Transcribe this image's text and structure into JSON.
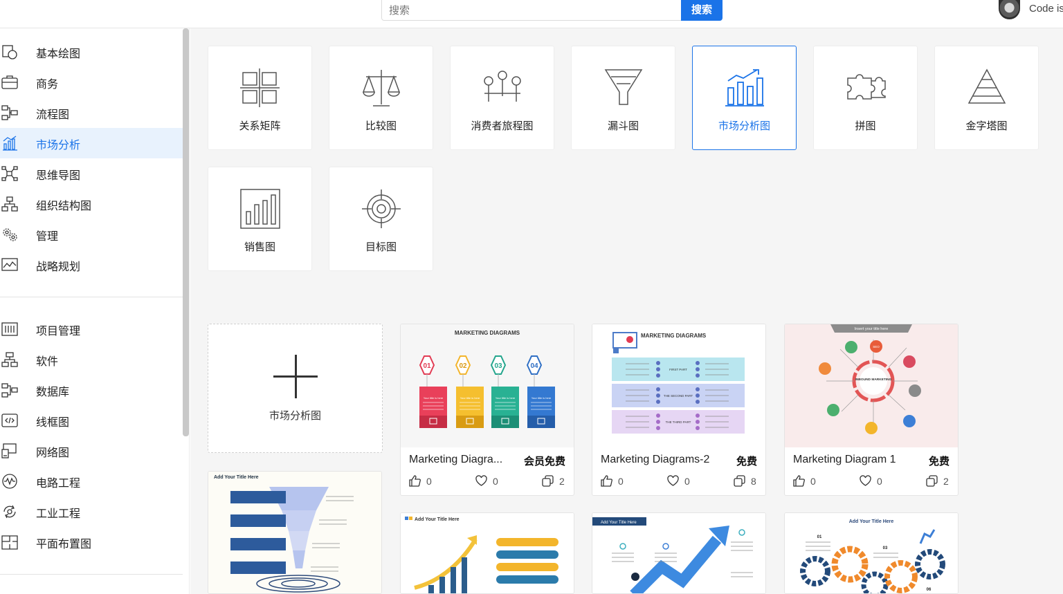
{
  "header": {
    "search_placeholder": "搜索",
    "search_button": "搜索",
    "user_name": "Code is"
  },
  "sidebar": {
    "group1": [
      {
        "label": "基本绘图",
        "icon": "shapes-icon"
      },
      {
        "label": "商务",
        "icon": "briefcase-icon"
      },
      {
        "label": "流程图",
        "icon": "flowchart-icon"
      },
      {
        "label": "市场分析",
        "icon": "bar-chart-icon",
        "active": true
      },
      {
        "label": "思维导图",
        "icon": "mindmap-icon"
      },
      {
        "label": "组织结构图",
        "icon": "org-chart-icon"
      },
      {
        "label": "管理",
        "icon": "gears-icon"
      },
      {
        "label": "战略规划",
        "icon": "line-chart-icon"
      }
    ],
    "group2": [
      {
        "label": "项目管理",
        "icon": "gantt-icon"
      },
      {
        "label": "软件",
        "icon": "software-icon"
      },
      {
        "label": "数据库",
        "icon": "database-icon"
      },
      {
        "label": "线框图",
        "icon": "wireframe-icon"
      },
      {
        "label": "网络图",
        "icon": "network-icon"
      },
      {
        "label": "电路工程",
        "icon": "circuit-icon"
      },
      {
        "label": "工业工程",
        "icon": "industrial-icon"
      },
      {
        "label": "平面布置图",
        "icon": "floorplan-icon"
      }
    ]
  },
  "categories": [
    {
      "label": "关系矩阵",
      "icon": "matrix-icon"
    },
    {
      "label": "比较图",
      "icon": "scale-icon"
    },
    {
      "label": "消费者旅程图",
      "icon": "journey-icon"
    },
    {
      "label": "漏斗图",
      "icon": "funnel-icon"
    },
    {
      "label": "市场分析图",
      "icon": "market-chart-icon",
      "active": true
    },
    {
      "label": "拼图",
      "icon": "puzzle-icon"
    },
    {
      "label": "金字塔图",
      "icon": "pyramid-icon"
    },
    {
      "label": "销售图",
      "icon": "sales-chart-icon"
    },
    {
      "label": "目标图",
      "icon": "target-icon"
    }
  ],
  "new_template": {
    "label": "市场分析图"
  },
  "templates": [
    {
      "title": "Marketing Diagra...",
      "price": "会员免费",
      "likes": "0",
      "favorites": "0",
      "copies": "2",
      "thumb_heading": "MARKETING DIAGRAMS",
      "steps": [
        "01",
        "02",
        "03",
        "04"
      ],
      "step_caption": "Your title is here"
    },
    {
      "title": "Marketing Diagrams-2",
      "price": "免费",
      "likes": "0",
      "favorites": "0",
      "copies": "8",
      "thumb_heading": "MARKETING DIAGRAMS",
      "parts": [
        "FIRST PART",
        "THE SECOND PART",
        "THE THIRD PART"
      ]
    },
    {
      "title": "Marketing Diagram 1",
      "price": "免费",
      "likes": "0",
      "favorites": "0",
      "copies": "2",
      "thumb_heading": "Insert your title here",
      "center_label": "INBOUND MARKETING",
      "seo": "SEO"
    }
  ],
  "row2": [
    {
      "thumb_heading": "Add Your Title Here"
    },
    {
      "thumb_heading": "Add Your Title Here"
    },
    {
      "thumb_heading": "Add Your Title Here"
    },
    {
      "thumb_heading": "Add Your Title Here",
      "labels": [
        "01",
        "03",
        "06"
      ]
    }
  ],
  "colors": {
    "accent": "#1a73e8",
    "active_bg": "#e8f2fd",
    "panel_bg": "#f5f5f5"
  }
}
